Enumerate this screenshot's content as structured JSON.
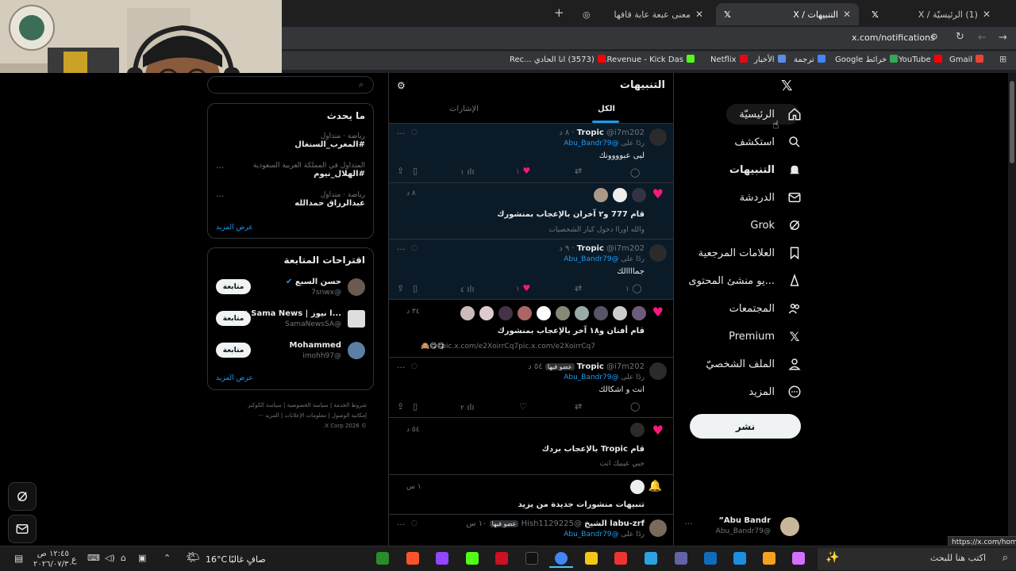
{
  "browser": {
    "tabs": [
      {
        "title": "(1) الرئيسيّة / X",
        "active": false
      },
      {
        "title": "التنبيهات / X",
        "active": true
      },
      {
        "title": "معنى عبعة عابة قافها",
        "active": false
      }
    ],
    "new_tab": "+",
    "url": "x.com/notifications",
    "bookmarks": [
      "Gmail",
      "YouTube",
      "خرائط Google",
      "ترجمة",
      "الأخبار",
      "Netflix",
      "Revenue - Kick Das...",
      "(3573) انا الحادي ...Rec"
    ],
    "status_url": "https://x.com/home"
  },
  "nav": {
    "items": [
      "الرئيسيّة",
      "استكشف",
      "التنبيهات",
      "الدردشة",
      "Grok",
      "العلامات المرجعية",
      "...يو منشئ المحتوى",
      "المجتمعات",
      "Premium",
      "الملف الشخصيّ",
      "المزيد"
    ],
    "post": "نشر",
    "account_name": "Abu Bandr”",
    "account_handle": "@Abu_Bandr79"
  },
  "notifications": {
    "title": "التنبيهات",
    "tabs": [
      "الكل",
      "الإشارات"
    ],
    "items": [
      {
        "name": "Tropic",
        "handle": "@i7m202",
        "time": "٨ د",
        "reply_to": "ردًا على",
        "reply_handle": "@Abu_Bandr79",
        "text": "لبى عبوووونك",
        "likes": "١",
        "views": "١"
      },
      {
        "time": "٨ د",
        "text": "قام 777 و٢ آخران بالإعجاب بمنشورك",
        "quote": "والله اوراا   دخول كبار الشخصيات"
      },
      {
        "name": "Tropic",
        "handle": "@i7m202",
        "time": "٩ د",
        "reply_to": "ردًا على",
        "reply_handle": "@Abu_Bandr79",
        "text": "جماااالك",
        "replies": "١",
        "likes": "١",
        "views": "٤"
      },
      {
        "time": "٣٤ د",
        "text": "قام أفنان و١٨ آخر بالإعجاب بمنشورك",
        "quote": "pic.x.com/e2XoirrCq7pic.x.com/e2XoirrCq7"
      },
      {
        "name": "Tropic",
        "handle": "@i7m202",
        "badge": "عضو فيها",
        "time": "٥٤ د",
        "reply_to": "ردًا على",
        "reply_handle": "@Abu_Bandr79",
        "text": "انت و اشكالك",
        "views": "٢"
      },
      {
        "time": "٥٤ د",
        "text": "قام Tropic بالإعجاب بردك",
        "quote": "حبي عينيك انت"
      },
      {
        "time": "١ س",
        "text": "تنبيهات منشورات جديدة من يزيد"
      },
      {
        "name": "labu-zrf الشيخ",
        "handle": "@Hish1129225",
        "badge": "عضو فيها",
        "time": "١٠ س",
        "reply_to": "ردًا على",
        "reply_handle": "@Abu_Bandr79"
      }
    ]
  },
  "trends": {
    "title": "ما يحدث",
    "items": [
      {
        "context": "رياضة · متداول",
        "name": "#المغرب_السنغال"
      },
      {
        "context": "المتداول في المملكة العربية السعودية",
        "name": "#الهلال_نيوم"
      },
      {
        "context": "رياضة · متداول",
        "name": "عبدالرزاق حمدالله"
      }
    ],
    "more": "عرض المزيد"
  },
  "who_to_follow": {
    "title": "اقتراحات المتابعة",
    "users": [
      {
        "name": "حسن السبع",
        "handle": "@7snwx",
        "button": "متابعة"
      },
      {
        "name": "...ا نيوز | Sama News",
        "handle": "@SamaNewsSA",
        "button": "متابعة"
      },
      {
        "name": "Mohammed",
        "handle": "@imohh97",
        "button": "متابعة"
      }
    ],
    "more": "عرض المزيد"
  },
  "footer": {
    "line1": "شروط الخدمة | سياسة الخصوصية | سياسة الكوكيز",
    "line2": "إمكانية الوصول | معلومات الإعلانات | المزيد ···",
    "copyright": "© 2026 X Corp."
  },
  "taskbar": {
    "search": "اكتب هنا للبحث",
    "weather_temp": "16°C",
    "weather_text": "صافٍ غالبًا",
    "time": "١٢:٤٥ ص",
    "date": "٢٠٢٦/٠٧/٣٠",
    "lang": "ع"
  },
  "colors": {
    "accent": "#1d9bf0",
    "like": "#f91880",
    "post_button": "#eff3f4"
  }
}
